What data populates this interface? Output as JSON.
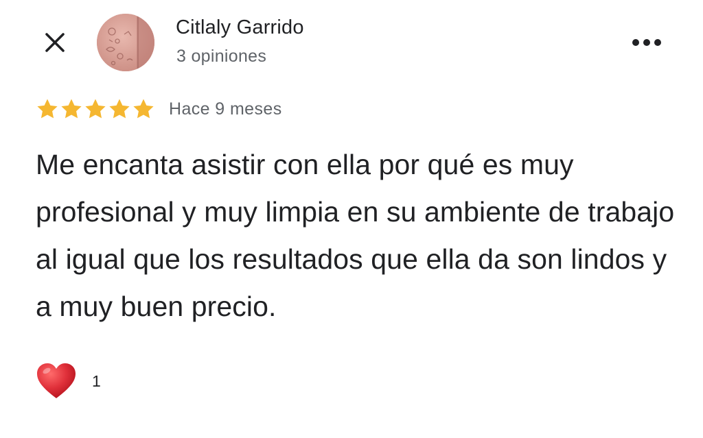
{
  "reviewer": {
    "name": "Citlaly Garrido",
    "review_count": "3 opiniones",
    "avatar_color": "#d9a39a"
  },
  "header": {
    "close_icon": "close-icon",
    "more_icon": "more-horizontal-icon"
  },
  "rating": {
    "stars": 5,
    "max_stars": 5,
    "star_color": "#f5b731",
    "age": "Hace 9 meses"
  },
  "review": {
    "text": "Me encanta asistir con ella por qué es muy profesional y muy limpia en su ambiente de trabajo al igual que los resultados que ella da son lindos y a muy buen precio."
  },
  "reactions": {
    "icon": "heart-icon",
    "count": "1",
    "heart_color": "#e0303a"
  }
}
